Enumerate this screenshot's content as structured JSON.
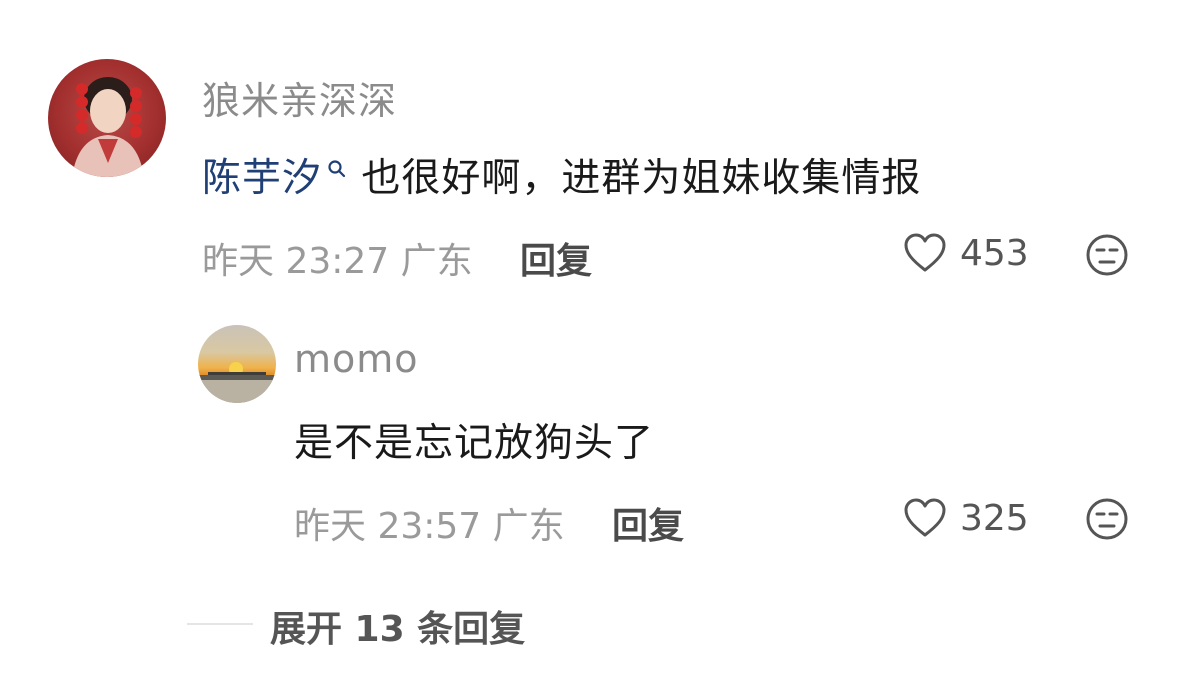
{
  "comment": {
    "author": "狼米亲深深",
    "mention": "陈芋汐",
    "body": " 也很好啊，进群为姐妹收集情报",
    "date": "昨天",
    "time": "23:27",
    "location": "广东",
    "reply_label": "回复",
    "like_count": "453"
  },
  "reply": {
    "author": "momo",
    "body": "是不是忘记放狗头了",
    "date": "昨天",
    "time": "23:57",
    "location": "广东",
    "reply_label": "回复",
    "like_count": "325"
  },
  "expand": {
    "label": "展开 13 条回复"
  },
  "icons": {
    "like": "heart-outline-icon",
    "emoji": "neutral-face-icon",
    "mention": "search-icon"
  },
  "colors": {
    "mention": "#1f3f75",
    "meta_text": "#9a9a9a",
    "primary_text": "#1a1a1a"
  }
}
